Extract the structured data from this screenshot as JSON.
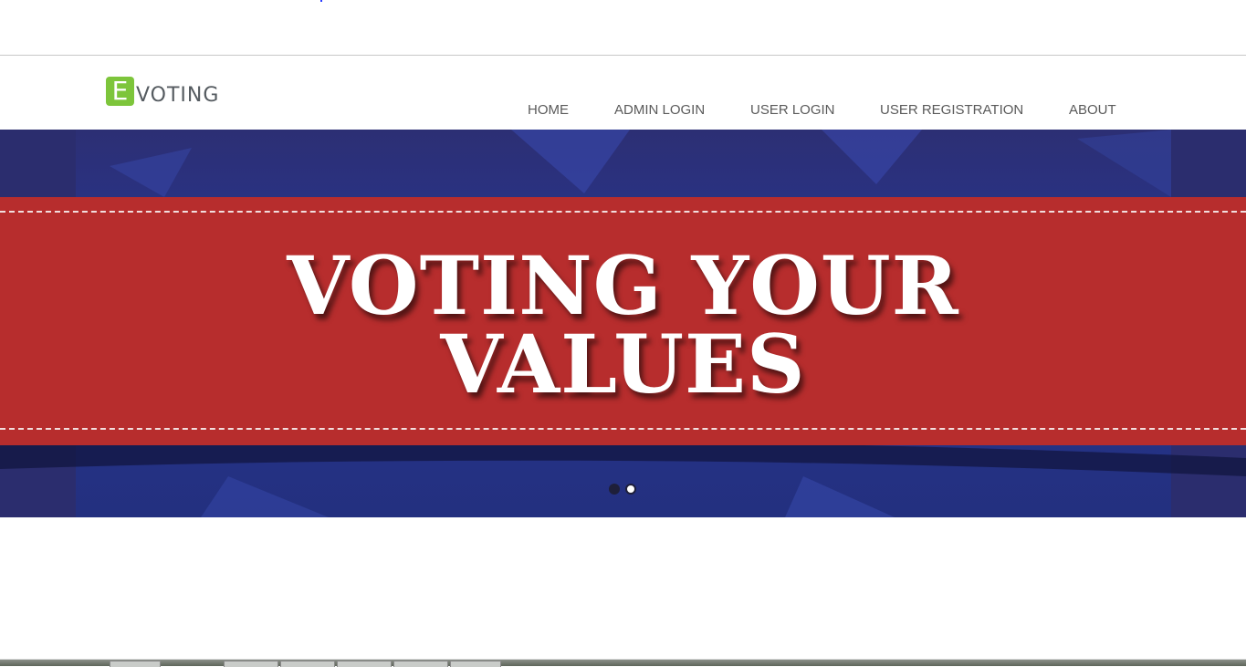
{
  "logo": {
    "letter": "E",
    "text": "VOTING",
    "accent_color": "#7dc53b"
  },
  "nav": {
    "items": [
      {
        "label": "HOME"
      },
      {
        "label": "ADMIN LOGIN"
      },
      {
        "label": "USER LOGIN"
      },
      {
        "label": "USER REGISTRATION"
      },
      {
        "label": "ABOUT"
      }
    ]
  },
  "hero": {
    "headline_line1": "VOTING YOUR",
    "headline_line2": "VALUES",
    "banner_color": "#b72d2d",
    "background_color": "#283591",
    "slides_total": 2,
    "active_slide": 2
  }
}
